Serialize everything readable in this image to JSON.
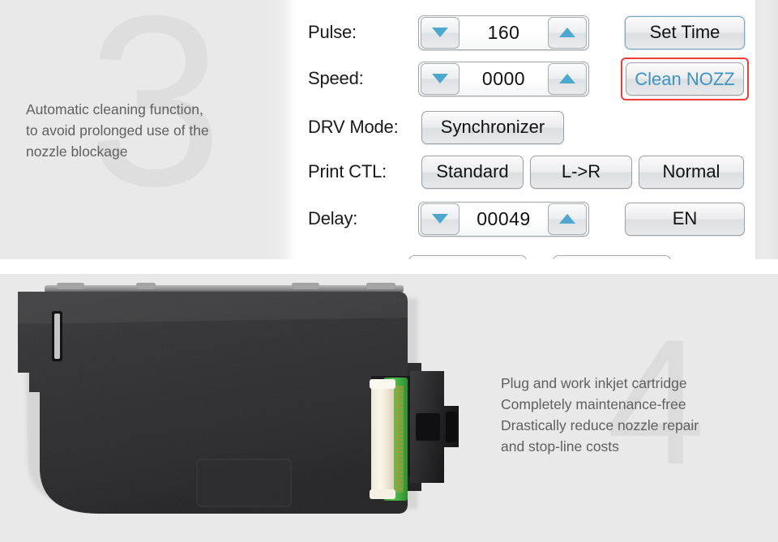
{
  "feature_3": {
    "number": "3",
    "lines": [
      "Automatic cleaning function,",
      "to avoid prolonged use of the",
      "nozzle blockage"
    ]
  },
  "feature_4": {
    "number": "4",
    "lines": [
      "Plug and work inkjet cartridge",
      "Completely maintenance-free",
      "Drastically reduce nozzle repair",
      "and stop-line costs"
    ]
  },
  "controller": {
    "rows": {
      "pulse": {
        "label": "Pulse:",
        "value": "160",
        "decrement_icon": "triangle-down-icon",
        "increment_icon": "triangle-up-icon",
        "action": "Set Time"
      },
      "speed": {
        "label": "Speed:",
        "value": "0000",
        "decrement_icon": "triangle-down-icon",
        "increment_icon": "triangle-up-icon",
        "action": "Clean NOZZ"
      },
      "drv_mode": {
        "label": "DRV Mode:",
        "value": "Synchronizer"
      },
      "print_ctl": {
        "label": "Print CTL:",
        "option_1": "Standard",
        "option_2": "L->R",
        "option_3": "Normal"
      },
      "delay": {
        "label": "Delay:",
        "value": "00049",
        "decrement_icon": "triangle-down-icon",
        "increment_icon": "triangle-up-icon",
        "action": "EN"
      }
    }
  },
  "colors": {
    "panel_background": "#e9e9e9",
    "watermark": "#dedede",
    "body_text": "#5f5f5f",
    "spinner_arrow": "#4ea7cd",
    "highlight_ring": "#ef3d3d",
    "clean_nozz_text": "#3f94bf",
    "set_time_border": "#7ba7c4",
    "button_face": "#e7e9eb",
    "cartridge_body": "#2e2e30",
    "connector_pcb": "#3fae3f",
    "connector_housing": "#f2ead6",
    "connector_pins": "#c9a646"
  },
  "cartridge": {
    "alt": "inkjet print cartridge with ribbon connector"
  }
}
